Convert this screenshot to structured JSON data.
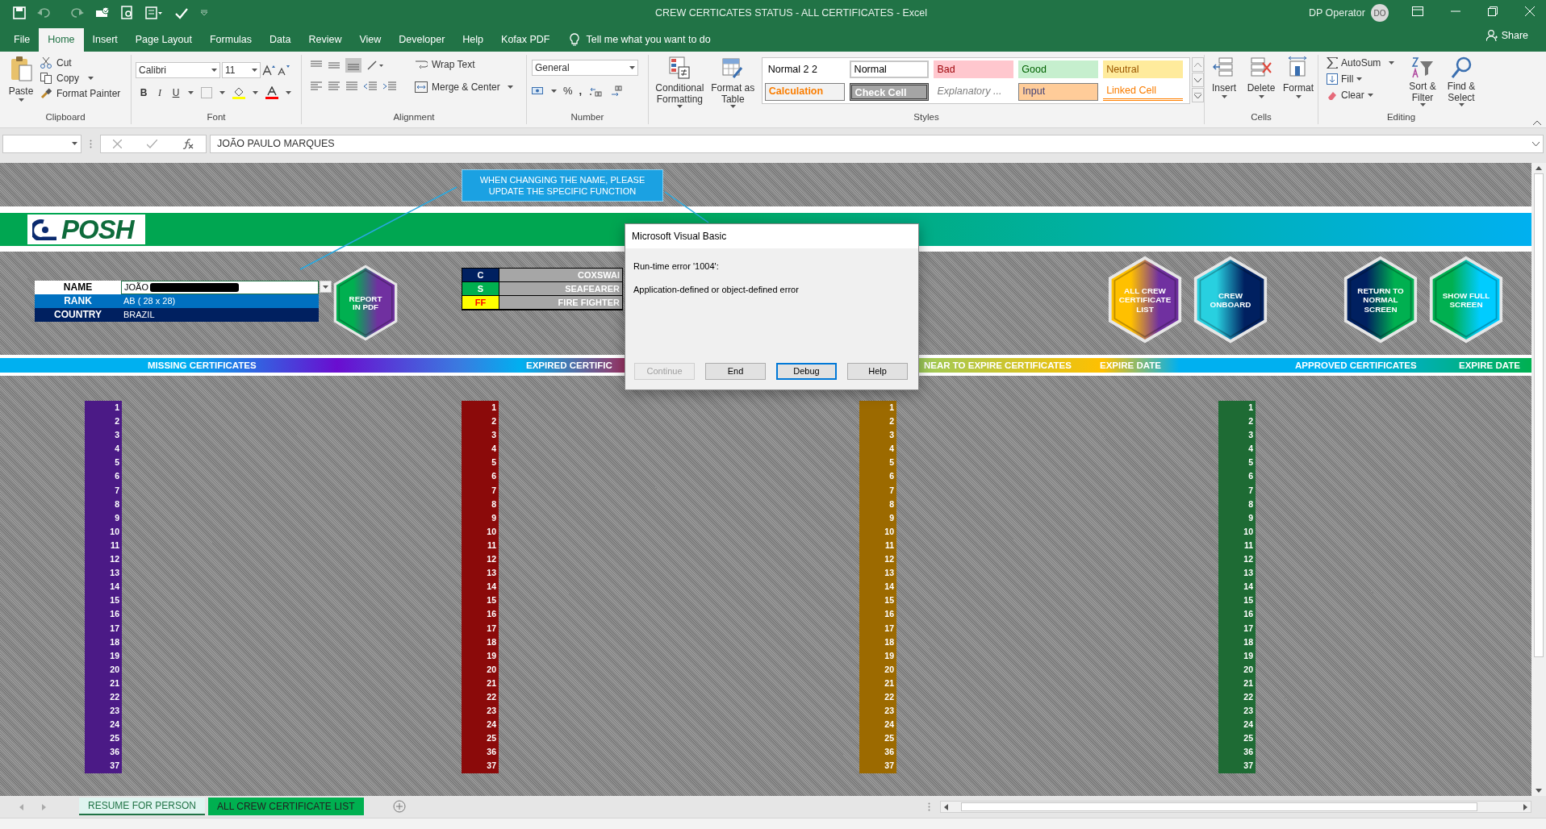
{
  "window": {
    "title": "CREW CERTICATES STATUS - ALL CERTIFICATES  -  Excel",
    "user": "DP Operator",
    "avatar": "DO"
  },
  "ribbon_tabs": [
    {
      "label": "File",
      "selected": false
    },
    {
      "label": "Home",
      "selected": true
    },
    {
      "label": "Insert",
      "selected": false
    },
    {
      "label": "Page Layout",
      "selected": false
    },
    {
      "label": "Formulas",
      "selected": false
    },
    {
      "label": "Data",
      "selected": false
    },
    {
      "label": "Review",
      "selected": false
    },
    {
      "label": "View",
      "selected": false
    },
    {
      "label": "Developer",
      "selected": false
    },
    {
      "label": "Help",
      "selected": false
    },
    {
      "label": "Kofax PDF",
      "selected": false
    }
  ],
  "tell_me": "Tell me what you want to do",
  "share": "Share",
  "clipboard": {
    "paste": "Paste",
    "cut": "Cut",
    "copy": "Copy",
    "format_painter": "Format Painter",
    "group": "Clipboard"
  },
  "font": {
    "name": "Calibri",
    "size": "11",
    "bold": "B",
    "italic": "I",
    "underline": "U",
    "group": "Font"
  },
  "alignment": {
    "wrap": "Wrap Text",
    "merge": "Merge & Center",
    "group": "Alignment"
  },
  "number": {
    "format": "General",
    "percent": "%",
    "comma": ",",
    "group": "Number"
  },
  "styles": {
    "conditional": "Conditional Formatting",
    "format_table": "Format as Table",
    "group": "Styles",
    "cells": [
      {
        "label": "Normal 2 2",
        "kind": "plain"
      },
      {
        "label": "Normal",
        "kind": "normal"
      },
      {
        "label": "Bad",
        "kind": "bad"
      },
      {
        "label": "Good",
        "kind": "good"
      },
      {
        "label": "Neutral",
        "kind": "neutral"
      },
      {
        "label": "Calculation",
        "kind": "calculation"
      },
      {
        "label": "Check Cell",
        "kind": "check"
      },
      {
        "label": "Explanatory ...",
        "kind": "explanatory"
      },
      {
        "label": "Input",
        "kind": "input"
      },
      {
        "label": "Linked Cell",
        "kind": "linked"
      }
    ]
  },
  "cells_group": {
    "buttons": [
      "Insert",
      "Delete",
      "Format"
    ],
    "group": "Cells"
  },
  "editing": {
    "autosum": "AutoSum",
    "fill": "Fill",
    "clear": "Clear",
    "sort": "Sort & Filter",
    "find": "Find & Select",
    "group": "Editing"
  },
  "formula_bar": {
    "value": "JOÃO PAULO MARQUES"
  },
  "sheet": {
    "note": "WHEN CHANGING THE NAME, PLEASE UPDATE THE SPECIFIC FUNCTION",
    "logo": "POSH",
    "info": [
      {
        "label": "NAME",
        "value": "JOÃO",
        "kind": "name"
      },
      {
        "label": "RANK",
        "value": "AB ( 28 x 28)",
        "kind": "rank"
      },
      {
        "label": "COUNTRY",
        "value": "BRAZIL",
        "kind": "country"
      }
    ],
    "legend": [
      {
        "code": "C",
        "label": "COXSWAI",
        "color": "#002060"
      },
      {
        "code": "S",
        "label": "SEAFEARER",
        "color": "#00b050"
      },
      {
        "code": "FF",
        "label": "FIRE FIGHTER",
        "color": "#ffff00"
      }
    ],
    "hex_buttons": [
      {
        "lines": [
          "REPORT",
          "IN PDF"
        ],
        "kind": "pdf"
      },
      {
        "lines": [
          "ALL CREW",
          "CERTIFICATE",
          "LIST"
        ],
        "kind": "all"
      },
      {
        "lines": [
          "CREW",
          "ONBOARD"
        ],
        "kind": "onboard"
      },
      {
        "lines": [
          "RETURN TO",
          "NORMAL",
          "SCREEN"
        ],
        "kind": "normal"
      },
      {
        "lines": [
          "SHOW FULL",
          "SCREEN"
        ],
        "kind": "full"
      }
    ],
    "sections": [
      "MISSING CERTIFICATES",
      "EXPIRED CERTIFIC",
      "NEAR TO EXPIRE CERTIFICATES",
      "EXPIRE DATE",
      "APPROVED CERTIFICATES",
      "EXPIRE DATE"
    ],
    "columns": [
      {
        "color": "#4b1a86",
        "numbers": [
          "1",
          "2",
          "3",
          "4",
          "5",
          "6",
          "7",
          "8",
          "9",
          "10",
          "11",
          "12",
          "13",
          "14",
          "15",
          "16",
          "17",
          "18",
          "19",
          "20",
          "21",
          "22",
          "23",
          "24",
          "25",
          "36",
          "37"
        ]
      },
      {
        "color": "#8b0a0a",
        "numbers": [
          "1",
          "2",
          "3",
          "4",
          "5",
          "6",
          "7",
          "8",
          "9",
          "10",
          "11",
          "12",
          "13",
          "14",
          "15",
          "16",
          "17",
          "18",
          "19",
          "20",
          "21",
          "22",
          "23",
          "24",
          "25",
          "36",
          "37"
        ]
      },
      {
        "color": "#9c6a00",
        "numbers": [
          "1",
          "2",
          "3",
          "4",
          "5",
          "6",
          "7",
          "8",
          "9",
          "10",
          "11",
          "12",
          "13",
          "14",
          "15",
          "16",
          "17",
          "18",
          "19",
          "20",
          "21",
          "22",
          "23",
          "24",
          "25",
          "36",
          "37"
        ]
      },
      {
        "color": "#1e6b34",
        "numbers": [
          "1",
          "2",
          "3",
          "4",
          "5",
          "6",
          "7",
          "8",
          "9",
          "10",
          "11",
          "12",
          "13",
          "14",
          "15",
          "16",
          "17",
          "18",
          "19",
          "20",
          "21",
          "22",
          "23",
          "24",
          "25",
          "36",
          "37"
        ]
      }
    ]
  },
  "dialog": {
    "title": "Microsoft Visual Basic",
    "message": "Run-time error '1004':",
    "detail": "Application-defined or object-defined error",
    "buttons": [
      {
        "label": "Continue",
        "disabled": true,
        "selected": false
      },
      {
        "label": "End",
        "disabled": false,
        "selected": false
      },
      {
        "label": "Debug",
        "disabled": false,
        "selected": true
      },
      {
        "label": "Help",
        "disabled": false,
        "selected": false
      }
    ]
  },
  "sheet_tabs": [
    {
      "label": "RESUME FOR PERSON",
      "selected": true
    },
    {
      "label": "ALL CREW CERTIFICATE LIST",
      "selected": false
    }
  ]
}
